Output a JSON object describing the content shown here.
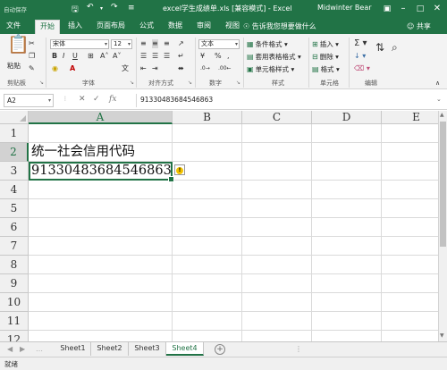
{
  "titlebar": {
    "autosave": "自动保存",
    "title": "excel学生成绩单.xls  [兼容模式] - Excel",
    "user": "Midwinter Bear"
  },
  "tabs": [
    "文件",
    "开始",
    "插入",
    "页面布局",
    "公式",
    "数据",
    "审阅",
    "视图"
  ],
  "tell_me": "告诉我您想要做什么",
  "share": "共享",
  "ribbon": {
    "clipboard": {
      "paste": "粘贴",
      "label": "剪贴板"
    },
    "font": {
      "name": "宋体",
      "size": "12",
      "label": "字体"
    },
    "alignment": {
      "label": "对齐方式"
    },
    "number": {
      "format": "文本",
      "label": "数字"
    },
    "styles": {
      "conditional": "条件格式",
      "table": "套用表格格式",
      "cell_styles": "单元格样式",
      "label": "样式"
    },
    "cells": {
      "insert": "插入",
      "delete": "删除",
      "format": "格式",
      "label": "单元格"
    },
    "editing": {
      "label": "编辑"
    }
  },
  "formula_bar": {
    "name_box": "A2",
    "formula": "91330483684546863"
  },
  "columns": [
    "A",
    "B",
    "C",
    "D",
    "E"
  ],
  "rows": [
    "1",
    "2",
    "3",
    "4",
    "5",
    "6",
    "7",
    "8",
    "9",
    "10",
    "11",
    "12"
  ],
  "cells": {
    "A1": "统一社会信用代码",
    "A2": "91330483684546863"
  },
  "sheets": [
    "Sheet1",
    "Sheet2",
    "Sheet3",
    "Sheet4"
  ],
  "active_sheet": "Sheet4",
  "status": "就绪",
  "colors": {
    "accent": "#217346"
  }
}
